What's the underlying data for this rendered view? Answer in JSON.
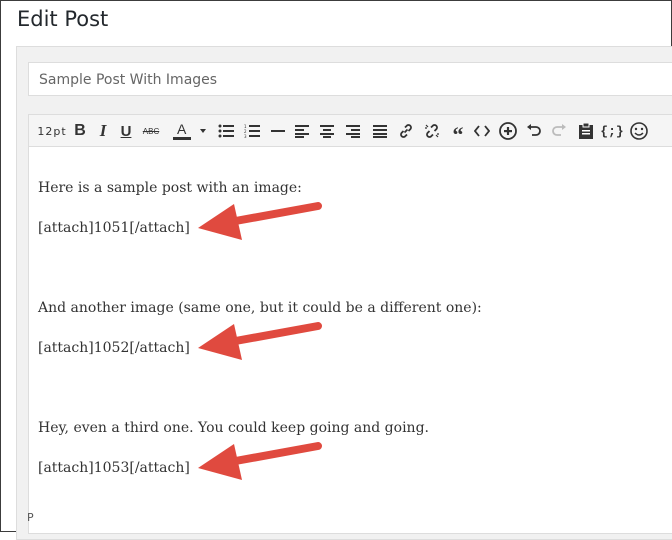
{
  "header": {
    "title": "Edit Post"
  },
  "post": {
    "title_value": "Sample Post With Images"
  },
  "toolbar": {
    "font_size": "12pt"
  },
  "content": {
    "paragraphs": [
      "Here is a sample post with an image:",
      "[attach]1051[/attach]",
      "And another image (same one, but it could be a different one):",
      "[attach]1052[/attach]",
      "Hey, even a third one. You could keep going and going.",
      "[attach]1053[/attach]"
    ]
  },
  "status": {
    "path": "P"
  },
  "colors": {
    "arrow": "#e04a3f",
    "toolbar_bg": "#f5f5f5",
    "panel_bg": "#f1f1f1"
  },
  "icons": [
    "bold-icon",
    "italic-icon",
    "underline-icon",
    "strikethrough-icon",
    "text-color-icon",
    "bullet-list-icon",
    "numbered-list-icon",
    "horizontal-line-icon",
    "align-left-icon",
    "align-center-icon",
    "align-right-icon",
    "justify-icon",
    "link-icon",
    "unlink-icon",
    "blockquote-icon",
    "code-icon",
    "insert-icon",
    "undo-icon",
    "redo-icon",
    "paste-icon",
    "shortcode-icon",
    "emoji-icon"
  ]
}
